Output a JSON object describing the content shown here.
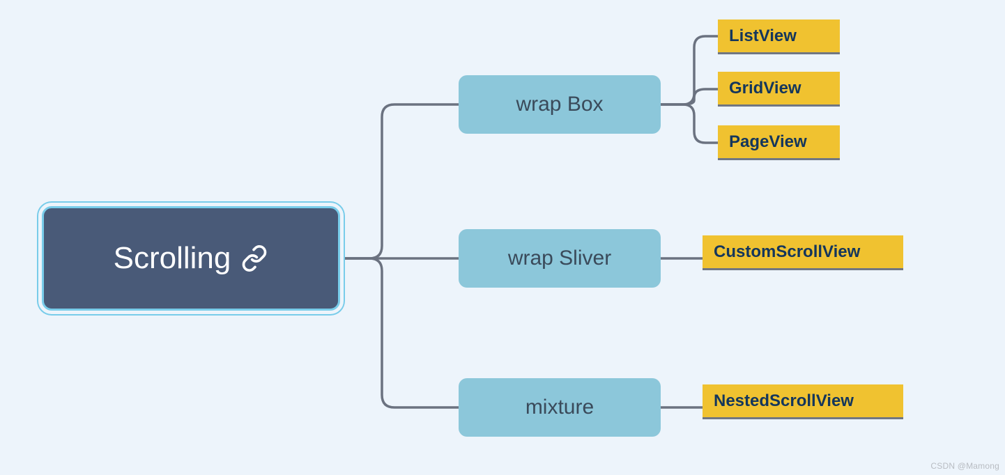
{
  "root": {
    "label": "Scrolling"
  },
  "branches": {
    "wrapBox": {
      "label": "wrap Box"
    },
    "wrapSliver": {
      "label": "wrap Sliver"
    },
    "mixture": {
      "label": "mixture"
    }
  },
  "leaves": {
    "listView": {
      "label": "ListView"
    },
    "gridView": {
      "label": "GridView"
    },
    "pageView": {
      "label": "PageView"
    },
    "customScrollView": {
      "label": "CustomScrollView"
    },
    "nestedScrollView": {
      "label": "NestedScrollView"
    }
  },
  "watermark": "CSDN @Mamong",
  "chart_data": {
    "type": "tree",
    "root": "Scrolling",
    "children": [
      {
        "name": "wrap Box",
        "children": [
          "ListView",
          "GridView",
          "PageView"
        ]
      },
      {
        "name": "wrap Sliver",
        "children": [
          "CustomScrollView"
        ]
      },
      {
        "name": "mixture",
        "children": [
          "NestedScrollView"
        ]
      }
    ]
  }
}
